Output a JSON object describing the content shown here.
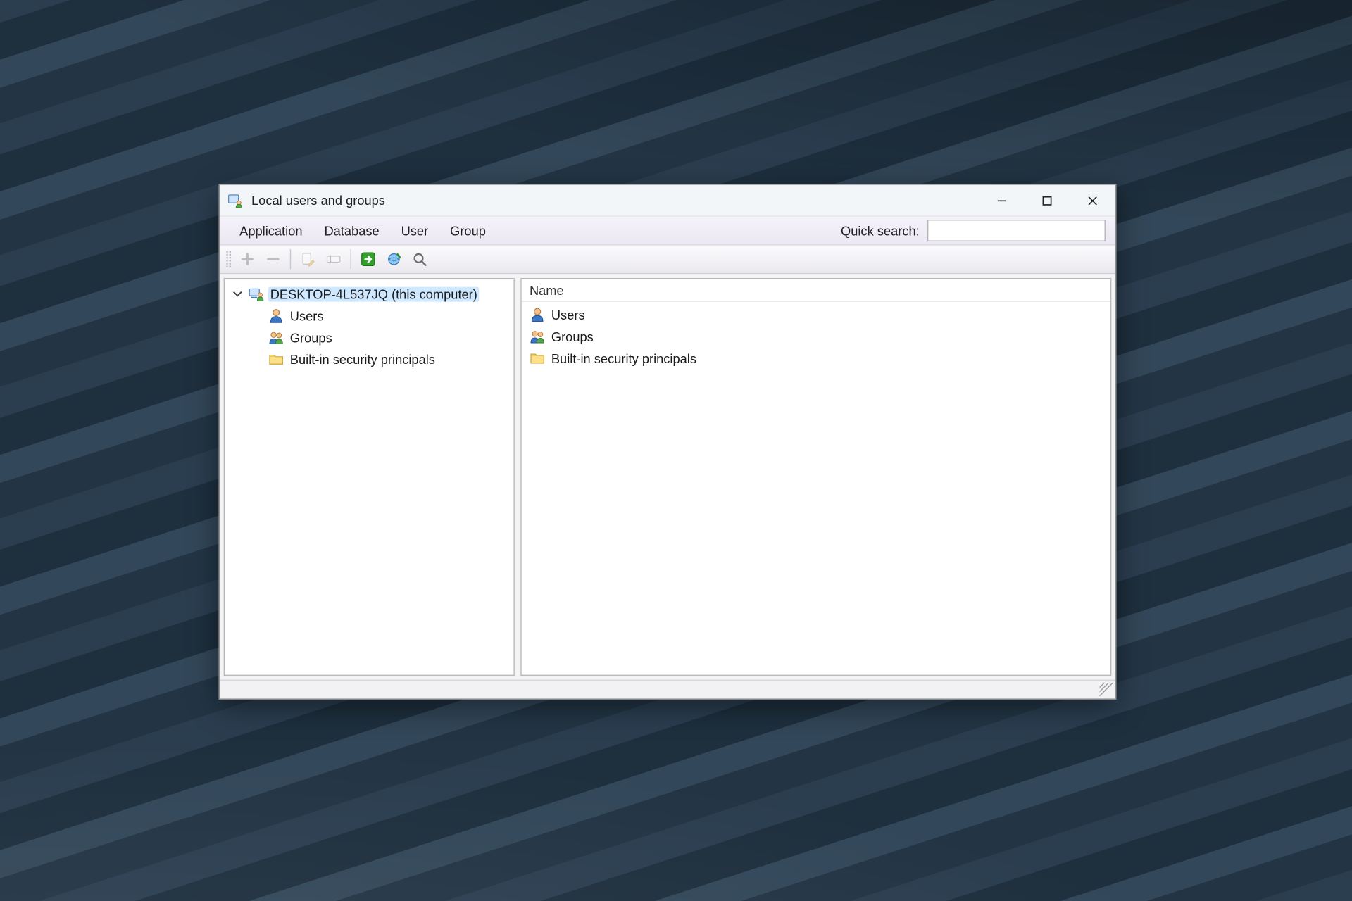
{
  "window": {
    "title": "Local users and groups"
  },
  "menu": {
    "items": [
      "Application",
      "Database",
      "User",
      "Group"
    ],
    "quick_search_label": "Quick search:",
    "quick_search_value": ""
  },
  "toolbar": {
    "buttons": [
      {
        "name": "add-button",
        "icon": "plus-icon",
        "disabled": true
      },
      {
        "name": "remove-button",
        "icon": "minus-icon",
        "disabled": true
      },
      {
        "sep": true
      },
      {
        "name": "edit-button",
        "icon": "page-edit-icon",
        "disabled": true
      },
      {
        "name": "rename-button",
        "icon": "rename-icon",
        "disabled": true
      },
      {
        "sep": true
      },
      {
        "name": "go-button",
        "icon": "arrow-right-green-icon",
        "disabled": false
      },
      {
        "name": "refresh-button",
        "icon": "refresh-globe-icon",
        "disabled": false
      },
      {
        "name": "search-button",
        "icon": "magnifier-icon",
        "disabled": false
      }
    ]
  },
  "tree": {
    "root": {
      "label": "DESKTOP-4L537JQ (this computer)",
      "icon": "computer-users-icon",
      "expanded": true,
      "selected": true,
      "children": [
        {
          "label": "Users",
          "icon": "user-icon"
        },
        {
          "label": "Groups",
          "icon": "group-icon"
        },
        {
          "label": "Built-in security principals",
          "icon": "folder-icon"
        }
      ]
    }
  },
  "list": {
    "columns": [
      "Name"
    ],
    "rows": [
      {
        "name": "Users",
        "icon": "user-icon"
      },
      {
        "name": "Groups",
        "icon": "group-icon"
      },
      {
        "name": "Built-in security principals",
        "icon": "folder-icon"
      }
    ]
  }
}
